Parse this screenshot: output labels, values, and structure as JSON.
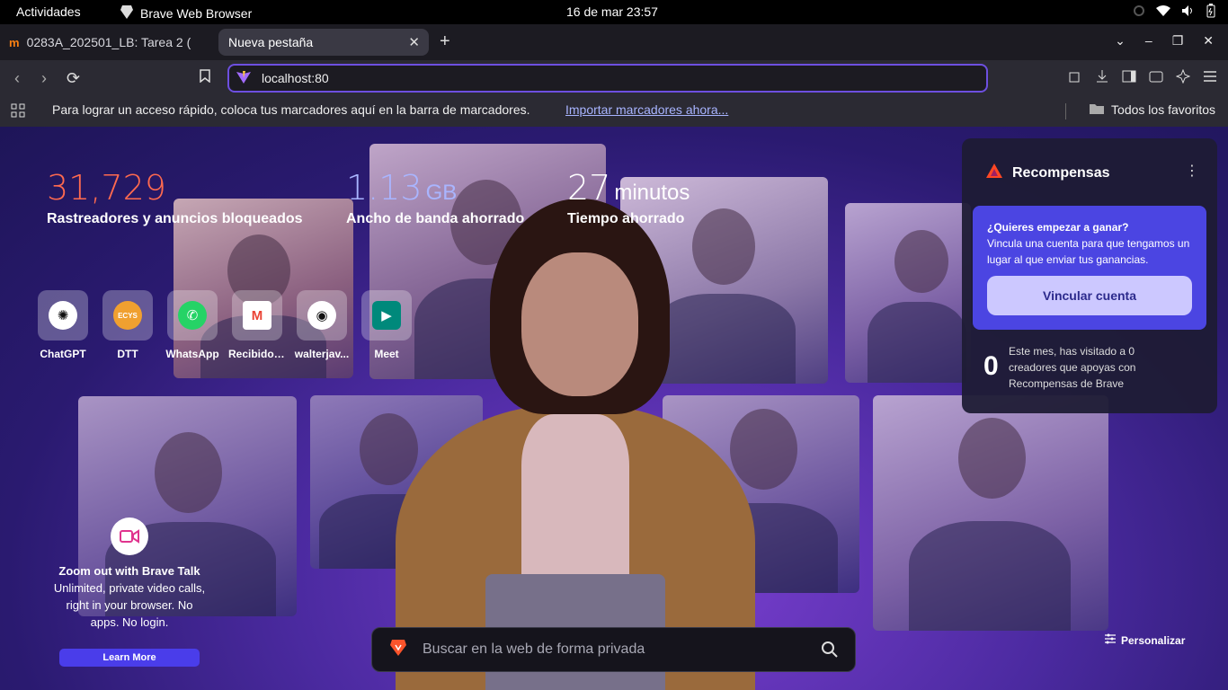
{
  "system_bar": {
    "activities": "Actividades",
    "app_name": "Brave Web Browser",
    "clock": "16 de mar  23:57"
  },
  "tabs": [
    {
      "label": "0283A_202501_LB: Tarea 2 (",
      "active": false
    },
    {
      "label": "Nueva pestaña",
      "active": true
    }
  ],
  "address_bar": {
    "value": "localhost:80"
  },
  "bookmarks_bar": {
    "hint": "Para lograr un acceso rápido, coloca tus marcadores aquí en la barra de marcadores.",
    "import_link": "Importar marcadores ahora...",
    "all_favorites": "Todos los favoritos"
  },
  "stats": {
    "trackers": {
      "value": "31,729",
      "label": "Rastreadores y anuncios bloqueados"
    },
    "bandwidth": {
      "value": "1.13",
      "unit": "GB",
      "label": "Ancho de banda ahorrado"
    },
    "time": {
      "value": "27",
      "unit": "minutos",
      "label": "Tiempo ahorrado"
    }
  },
  "top_sites": [
    {
      "label": "ChatGPT",
      "icon": "chatgpt-icon",
      "color": "#ffffff"
    },
    {
      "label": "DTT",
      "icon": "ecys-icon",
      "color": "#f0a030"
    },
    {
      "label": "WhatsApp",
      "icon": "whatsapp-icon",
      "color": "#25d366"
    },
    {
      "label": "Recibidos...",
      "icon": "gmail-icon",
      "color": "#ea4335"
    },
    {
      "label": "walterjav...",
      "icon": "github-icon",
      "color": "#ffffff"
    },
    {
      "label": "Meet",
      "icon": "google-meet-icon",
      "color": "#00897b"
    }
  ],
  "brave_talk": {
    "title": "Zoom out with Brave Talk",
    "description": "Unlimited, private video calls, right in your browser. No apps. No login.",
    "button": "Learn More"
  },
  "search": {
    "placeholder": "Buscar en la web de forma privada"
  },
  "customize": "Personalizar",
  "rewards": {
    "title": "Recompensas",
    "promo_question": "¿Quieres empezar a ganar?",
    "promo_desc": "Vincula una cuenta para que tengamos un lugar al que enviar tus ganancias.",
    "promo_button": "Vincular cuenta",
    "creators_count": "0",
    "creators_text": "Este mes, has visitado a 0 creadores que apoyas con Recompensas de Brave"
  },
  "colors": {
    "accent": "#6d4fe0",
    "trackers_value": "#ff6a4f",
    "bandwidth_value": "#a9b5ff",
    "promo_bg": "#4b45e2"
  }
}
